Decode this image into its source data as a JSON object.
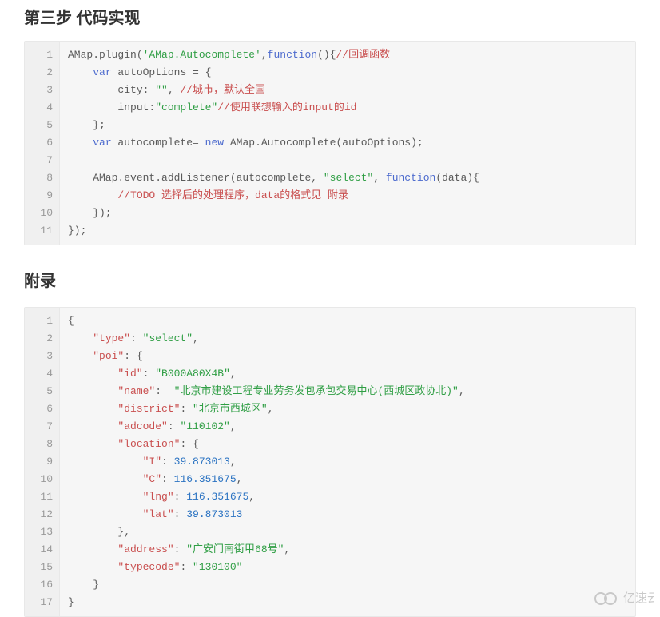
{
  "headings": {
    "step3": "第三步 代码实现",
    "appendix": "附录"
  },
  "block1": {
    "lineCount": 11,
    "lines": [
      [
        {
          "t": "AMap.plugin(",
          "c": ""
        },
        {
          "t": "'AMap.Autocomplete'",
          "c": "tok-string"
        },
        {
          "t": ",",
          "c": ""
        },
        {
          "t": "function",
          "c": "tok-func"
        },
        {
          "t": "(){",
          "c": ""
        },
        {
          "t": "//回调函数",
          "c": "tok-comment"
        }
      ],
      [
        {
          "t": "    ",
          "c": ""
        },
        {
          "t": "var",
          "c": "tok-keyword"
        },
        {
          "t": " autoOptions = {",
          "c": ""
        }
      ],
      [
        {
          "t": "        city: ",
          "c": ""
        },
        {
          "t": "\"\"",
          "c": "tok-string"
        },
        {
          "t": ", ",
          "c": ""
        },
        {
          "t": "//城市，默认全国",
          "c": "tok-comment"
        }
      ],
      [
        {
          "t": "        input:",
          "c": ""
        },
        {
          "t": "\"complete\"",
          "c": "tok-string"
        },
        {
          "t": "//使用联想输入的input的id",
          "c": "tok-comment"
        }
      ],
      [
        {
          "t": "    };",
          "c": ""
        }
      ],
      [
        {
          "t": "    ",
          "c": ""
        },
        {
          "t": "var",
          "c": "tok-keyword"
        },
        {
          "t": " autocomplete= ",
          "c": ""
        },
        {
          "t": "new",
          "c": "tok-keyword"
        },
        {
          "t": " AMap.Autocomplete(autoOptions);",
          "c": ""
        }
      ],
      [
        {
          "t": "",
          "c": ""
        }
      ],
      [
        {
          "t": "    AMap.event.addListener(autocomplete, ",
          "c": ""
        },
        {
          "t": "\"select\"",
          "c": "tok-string"
        },
        {
          "t": ", ",
          "c": ""
        },
        {
          "t": "function",
          "c": "tok-func"
        },
        {
          "t": "(data){",
          "c": ""
        }
      ],
      [
        {
          "t": "        ",
          "c": ""
        },
        {
          "t": "//TODO 选择后的处理程序，data的格式见 附录",
          "c": "tok-comment"
        }
      ],
      [
        {
          "t": "    });",
          "c": ""
        }
      ],
      [
        {
          "t": "});",
          "c": ""
        }
      ]
    ]
  },
  "block2": {
    "lineCount": 17,
    "lines": [
      [
        {
          "t": "{",
          "c": ""
        }
      ],
      [
        {
          "t": "    ",
          "c": ""
        },
        {
          "t": "\"type\"",
          "c": "tok-prop"
        },
        {
          "t": ": ",
          "c": ""
        },
        {
          "t": "\"select\"",
          "c": "tok-string"
        },
        {
          "t": ",",
          "c": ""
        }
      ],
      [
        {
          "t": "    ",
          "c": ""
        },
        {
          "t": "\"poi\"",
          "c": "tok-prop"
        },
        {
          "t": ": {",
          "c": ""
        }
      ],
      [
        {
          "t": "        ",
          "c": ""
        },
        {
          "t": "\"id\"",
          "c": "tok-prop"
        },
        {
          "t": ": ",
          "c": ""
        },
        {
          "t": "\"B000A80X4B\"",
          "c": "tok-string"
        },
        {
          "t": ",",
          "c": ""
        }
      ],
      [
        {
          "t": "        ",
          "c": ""
        },
        {
          "t": "\"name\"",
          "c": "tok-prop"
        },
        {
          "t": ":  ",
          "c": ""
        },
        {
          "t": "\"北京市建设工程专业劳务发包承包交易中心(西城区政协北)\"",
          "c": "tok-string"
        },
        {
          "t": ",",
          "c": ""
        }
      ],
      [
        {
          "t": "        ",
          "c": ""
        },
        {
          "t": "\"district\"",
          "c": "tok-prop"
        },
        {
          "t": ": ",
          "c": ""
        },
        {
          "t": "\"北京市西城区\"",
          "c": "tok-string"
        },
        {
          "t": ",",
          "c": ""
        }
      ],
      [
        {
          "t": "        ",
          "c": ""
        },
        {
          "t": "\"adcode\"",
          "c": "tok-prop"
        },
        {
          "t": ": ",
          "c": ""
        },
        {
          "t": "\"110102\"",
          "c": "tok-string"
        },
        {
          "t": ",",
          "c": ""
        }
      ],
      [
        {
          "t": "        ",
          "c": ""
        },
        {
          "t": "\"location\"",
          "c": "tok-prop"
        },
        {
          "t": ": {",
          "c": ""
        }
      ],
      [
        {
          "t": "            ",
          "c": ""
        },
        {
          "t": "\"I\"",
          "c": "tok-prop"
        },
        {
          "t": ": ",
          "c": ""
        },
        {
          "t": "39.873013",
          "c": "tok-number"
        },
        {
          "t": ",",
          "c": ""
        }
      ],
      [
        {
          "t": "            ",
          "c": ""
        },
        {
          "t": "\"C\"",
          "c": "tok-prop"
        },
        {
          "t": ": ",
          "c": ""
        },
        {
          "t": "116.351675",
          "c": "tok-number"
        },
        {
          "t": ",",
          "c": ""
        }
      ],
      [
        {
          "t": "            ",
          "c": ""
        },
        {
          "t": "\"lng\"",
          "c": "tok-prop"
        },
        {
          "t": ": ",
          "c": ""
        },
        {
          "t": "116.351675",
          "c": "tok-number"
        },
        {
          "t": ",",
          "c": ""
        }
      ],
      [
        {
          "t": "            ",
          "c": ""
        },
        {
          "t": "\"lat\"",
          "c": "tok-prop"
        },
        {
          "t": ": ",
          "c": ""
        },
        {
          "t": "39.873013",
          "c": "tok-number"
        }
      ],
      [
        {
          "t": "        },",
          "c": ""
        }
      ],
      [
        {
          "t": "        ",
          "c": ""
        },
        {
          "t": "\"address\"",
          "c": "tok-prop"
        },
        {
          "t": ": ",
          "c": ""
        },
        {
          "t": "\"广安门南街甲68号\"",
          "c": "tok-string"
        },
        {
          "t": ",",
          "c": ""
        }
      ],
      [
        {
          "t": "        ",
          "c": ""
        },
        {
          "t": "\"typecode\"",
          "c": "tok-prop"
        },
        {
          "t": ": ",
          "c": ""
        },
        {
          "t": "\"130100\"",
          "c": "tok-string"
        }
      ],
      [
        {
          "t": "    }",
          "c": ""
        }
      ],
      [
        {
          "t": "}",
          "c": ""
        }
      ]
    ]
  },
  "watermark": "亿速云"
}
